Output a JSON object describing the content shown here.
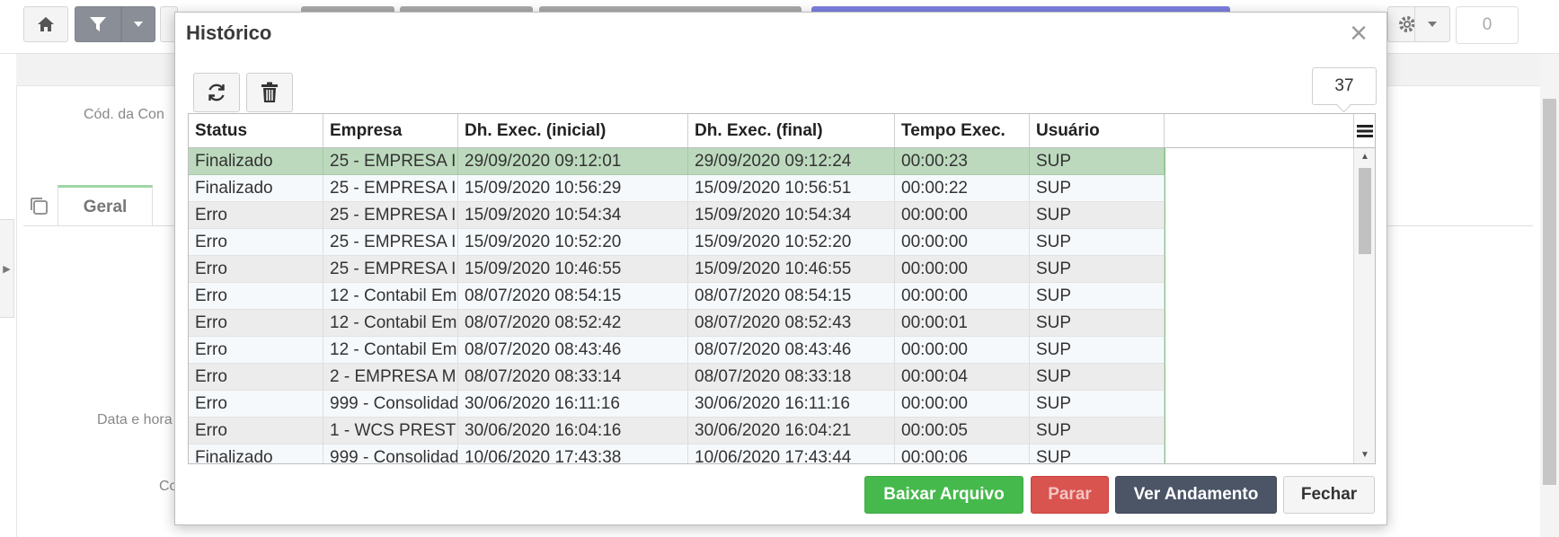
{
  "background": {
    "top_counter": "0",
    "labels": {
      "cod": "Cód. da Con",
      "data_hora": "Data e hora",
      "co": "Co"
    },
    "tab_geral": "Geral"
  },
  "modal": {
    "title": "Histórico",
    "record_count": "37",
    "columns": [
      "Status",
      "Empresa",
      "Dh. Exec. (inicial)",
      "Dh. Exec. (final)",
      "Tempo Exec.",
      "Usuário"
    ],
    "rows": [
      {
        "status": "Finalizado",
        "empresa": "25 - EMPRESA I",
        "inicial": "29/09/2020 09:12:01",
        "final": "29/09/2020 09:12:24",
        "tempo": "00:00:23",
        "usuario": "SUP"
      },
      {
        "status": "Finalizado",
        "empresa": "25 - EMPRESA I",
        "inicial": "15/09/2020 10:56:29",
        "final": "15/09/2020 10:56:51",
        "tempo": "00:00:22",
        "usuario": "SUP"
      },
      {
        "status": "Erro",
        "empresa": "25 - EMPRESA I",
        "inicial": "15/09/2020 10:54:34",
        "final": "15/09/2020 10:54:34",
        "tempo": "00:00:00",
        "usuario": "SUP"
      },
      {
        "status": "Erro",
        "empresa": "25 - EMPRESA I",
        "inicial": "15/09/2020 10:52:20",
        "final": "15/09/2020 10:52:20",
        "tempo": "00:00:00",
        "usuario": "SUP"
      },
      {
        "status": "Erro",
        "empresa": "25 - EMPRESA I",
        "inicial": "15/09/2020 10:46:55",
        "final": "15/09/2020 10:46:55",
        "tempo": "00:00:00",
        "usuario": "SUP"
      },
      {
        "status": "Erro",
        "empresa": "12 - Contabil Em",
        "inicial": "08/07/2020 08:54:15",
        "final": "08/07/2020 08:54:15",
        "tempo": "00:00:00",
        "usuario": "SUP"
      },
      {
        "status": "Erro",
        "empresa": "12 - Contabil Em",
        "inicial": "08/07/2020 08:52:42",
        "final": "08/07/2020 08:52:43",
        "tempo": "00:00:01",
        "usuario": "SUP"
      },
      {
        "status": "Erro",
        "empresa": "12 - Contabil Em",
        "inicial": "08/07/2020 08:43:46",
        "final": "08/07/2020 08:43:46",
        "tempo": "00:00:00",
        "usuario": "SUP"
      },
      {
        "status": "Erro",
        "empresa": "2 - EMPRESA M",
        "inicial": "08/07/2020 08:33:14",
        "final": "08/07/2020 08:33:18",
        "tempo": "00:00:04",
        "usuario": "SUP"
      },
      {
        "status": "Erro",
        "empresa": "999 - Consolidad",
        "inicial": "30/06/2020 16:11:16",
        "final": "30/06/2020 16:11:16",
        "tempo": "00:00:00",
        "usuario": "SUP"
      },
      {
        "status": "Erro",
        "empresa": "1 - WCS PREST",
        "inicial": "30/06/2020 16:04:16",
        "final": "30/06/2020 16:04:21",
        "tempo": "00:00:05",
        "usuario": "SUP"
      },
      {
        "status": "Finalizado",
        "empresa": "999 - Consolidad",
        "inicial": "10/06/2020 17:43:38",
        "final": "10/06/2020 17:43:44",
        "tempo": "00:00:06",
        "usuario": "SUP"
      }
    ],
    "selected_row": 0,
    "buttons": {
      "baixar": "Baixar Arquivo",
      "parar": "Parar",
      "ver_andamento": "Ver Andamento",
      "fechar": "Fechar"
    },
    "icons": {
      "refresh": "refresh-icon",
      "delete": "trash-icon",
      "columns": "column-menu-icon",
      "close": "close-icon"
    }
  }
}
